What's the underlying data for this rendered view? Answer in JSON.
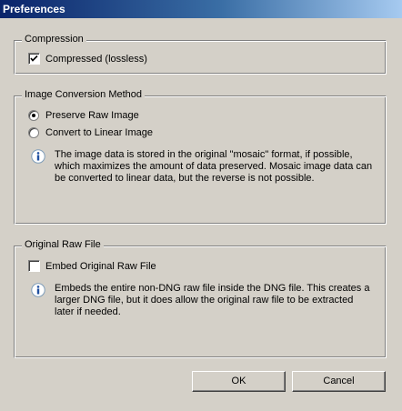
{
  "window": {
    "title": "Preferences"
  },
  "compression": {
    "title": "Compression",
    "checkbox_label": "Compressed (lossless)",
    "checked": true
  },
  "conversion": {
    "title": "Image Conversion Method",
    "options": [
      {
        "label": "Preserve Raw Image",
        "selected": true
      },
      {
        "label": "Convert to Linear Image",
        "selected": false
      }
    ],
    "info_text": "The image data is stored in the original \"mosaic\" format, if possible, which maximizes the amount of data preserved.  Mosaic image data can be converted to linear data, but the reverse is not possible."
  },
  "original_raw": {
    "title": "Original Raw File",
    "checkbox_label": "Embed Original Raw File",
    "checked": false,
    "info_text": "Embeds the entire non-DNG raw file inside the DNG file.  This creates a larger DNG file, but it does allow the original raw file to be extracted later if needed."
  },
  "buttons": {
    "ok": "OK",
    "cancel": "Cancel"
  },
  "icons": {
    "info": "info-icon",
    "check": "checkmark-icon"
  }
}
